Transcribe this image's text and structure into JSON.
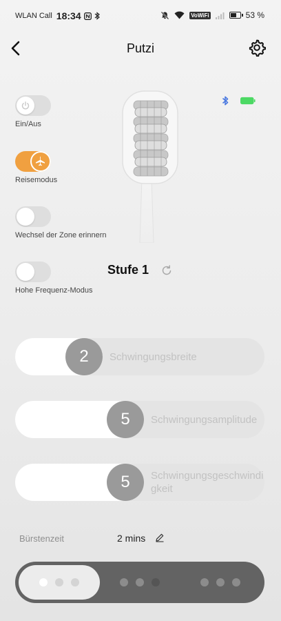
{
  "status_bar": {
    "carrier": "WLAN Call",
    "time": "18:34",
    "vowifi": "VoWiFi",
    "battery_percent": "53 %"
  },
  "header": {
    "title": "Putzi"
  },
  "device": {
    "accent_blue": "#4a78e0",
    "battery_color": "#4cd964"
  },
  "toggles": [
    {
      "label": "Ein/Aus",
      "on": false
    },
    {
      "label": "Reisemodus",
      "on": true
    },
    {
      "label": "Wechsel der Zone erinnern",
      "on": false
    },
    {
      "label": "Hohe Frequenz-Modus",
      "on": false
    }
  ],
  "level": {
    "label": "Stufe 1"
  },
  "sliders": [
    {
      "value": "2",
      "label": "Schwingungsbreite",
      "level_fraction": 0.2
    },
    {
      "value": "5",
      "label": "Schwingungsamplitude",
      "level_fraction": 0.5
    },
    {
      "value": "5",
      "label": "Schwingungsgeschwindigkeit",
      "level_fraction": 0.5
    }
  ],
  "brush_time": {
    "label": "Bürstenzeit",
    "value": "2 mins"
  },
  "modes": {
    "selected_index": 0,
    "count": 3,
    "accent": "#f0a040"
  }
}
